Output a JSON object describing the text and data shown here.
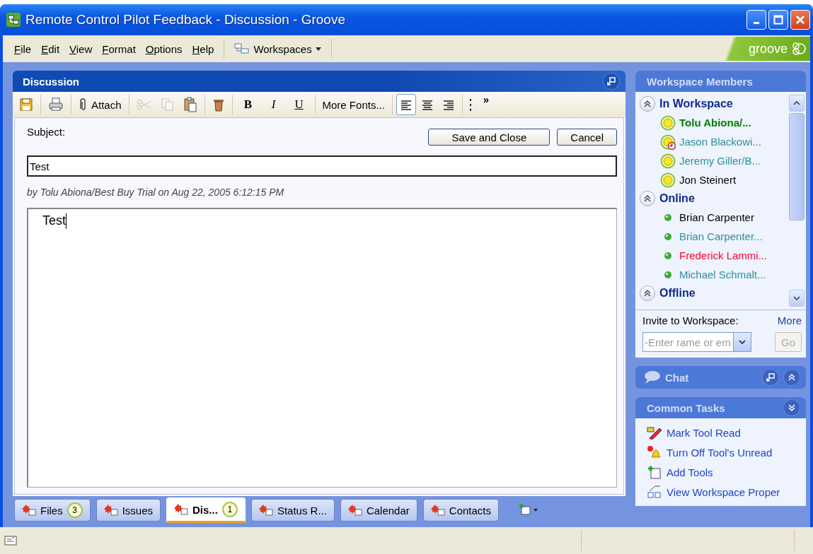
{
  "window": {
    "title": "Remote Control Pilot Feedback - Discussion - Groove"
  },
  "menu": [
    "File",
    "Edit",
    "View",
    "Format",
    "Options",
    "Help"
  ],
  "workspaces_button": "Workspaces",
  "logo": "groove",
  "panel": {
    "title": "Discussion"
  },
  "toolbar": {
    "attach": "Attach",
    "cut_disabled": true,
    "copy_disabled": true,
    "bold": "B",
    "italic": "I",
    "underline": "U",
    "more_fonts": "More Fonts...",
    "align": [
      {
        "selected": true
      },
      {
        "selected": false
      },
      {
        "selected": false
      }
    ],
    "overflow": "»"
  },
  "form": {
    "subject_label": "Subject:",
    "save_button": "Save and Close",
    "cancel_button": "Cancel",
    "subject_value": "Test",
    "byline": "by Tolu Abiona/Best Buy Trial on Aug 22, 2005 6:12:15 PM",
    "body": "Test"
  },
  "tabs": [
    {
      "label": "Files",
      "badge": "3",
      "selected": false
    },
    {
      "label": "Issues",
      "selected": false
    },
    {
      "label": "Dis...",
      "badge": "1",
      "selected": true
    },
    {
      "label": "Status R...",
      "selected": false
    },
    {
      "label": "Calendar",
      "selected": false
    },
    {
      "label": "Contacts",
      "selected": false
    }
  ],
  "members": {
    "title": "Workspace Members",
    "sections": [
      {
        "label": "In Workspace",
        "kind": "active",
        "children": [
          {
            "name": "Tolu Abiona/...",
            "color": "#008000",
            "highlighted": true,
            "idle": false
          },
          {
            "name": "Jason Blackowi...",
            "color": "#2f8f9a",
            "highlighted": false,
            "idle": true
          },
          {
            "name": "Jeremy Giller/B...",
            "color": "#2f8f9a",
            "highlighted": false,
            "idle": false
          },
          {
            "name": "Jon Steinert",
            "color": "#000000",
            "highlighted": false,
            "idle": false
          }
        ]
      },
      {
        "label": "Online",
        "kind": "online",
        "children": [
          {
            "name": "Brian Carpenter",
            "color": "#000000",
            "highlighted": false
          },
          {
            "name": "Brian Carpenter...",
            "color": "#2f8f9a",
            "highlighted": false
          },
          {
            "name": "Frederick Lammi...",
            "color": "#ff0030",
            "highlighted": false
          },
          {
            "name": "Michael Schmalt...",
            "color": "#2f8f9a",
            "highlighted": false
          }
        ]
      },
      {
        "label": "Offline"
      }
    ],
    "invite_label": "Invite to Workspace:",
    "more_link": "More",
    "invite_placeholder": "-Enter rame or em",
    "go_button": "Go",
    "go_disabled": true
  },
  "chat": {
    "title": "Chat"
  },
  "tasks": {
    "title": "Common Tasks",
    "items": [
      "Mark Tool Read",
      "Turn Off Tool's Unread",
      "Add Tools",
      "View Workspace Proper"
    ]
  }
}
